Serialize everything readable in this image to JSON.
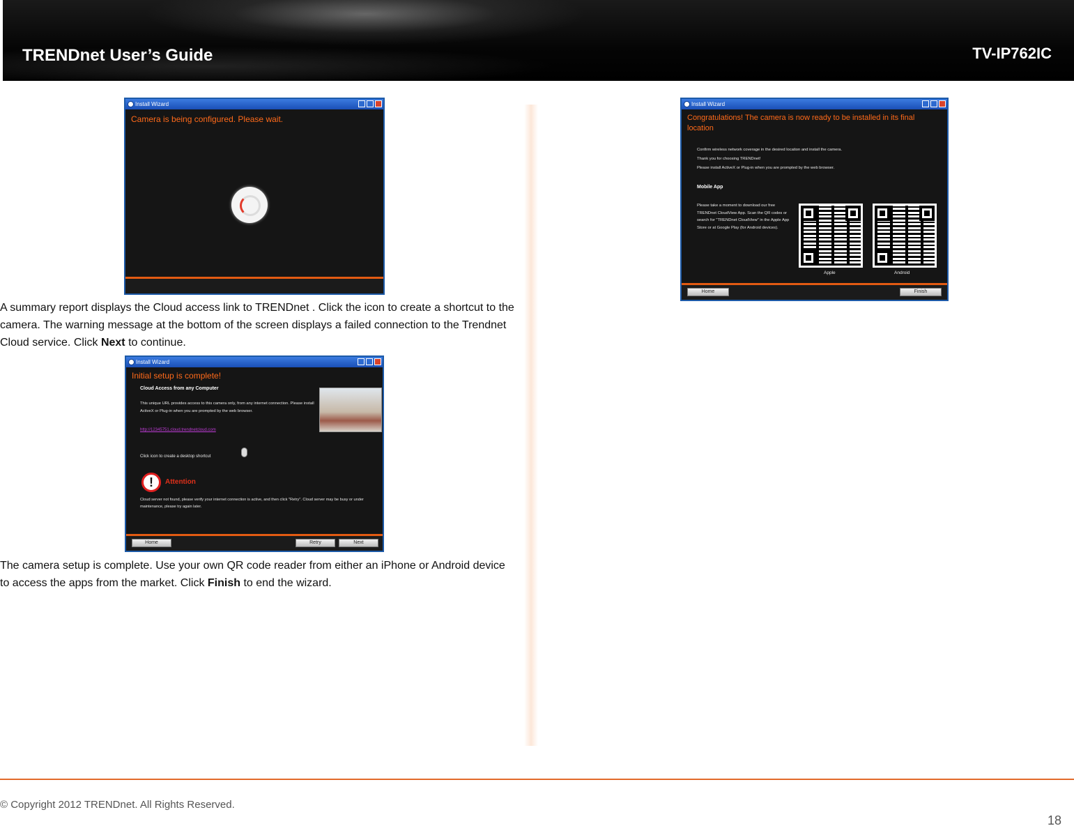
{
  "header": {
    "title": "TRENDnet User’s Guide",
    "model": "TV-IP762IC"
  },
  "screenshot1": {
    "window_title": "Install Wizard",
    "heading": "Camera is being configured. Please wait."
  },
  "paragraph1": {
    "text_before": "A summary report displays the Cloud access link to TRENDnet . Click the icon to create a shortcut to the camera. The warning message at the bottom of the screen displays a failed connection to the Trendnet Cloud service. Click ",
    "bold": "Next",
    "text_after": " to continue."
  },
  "screenshot2": {
    "window_title": "Install Wizard",
    "heading": "Initial setup is complete!",
    "section_title": "Cloud Access from any Computer",
    "description": "This unique URL provides access to this camera only, from any internet connection. Please install ActiveX or Plug-in when you are prompted by the web browser.",
    "link": "http://12345751.cloud.trendnetcloud.com",
    "shortcut_text": "Click icon to create a desktop shortcut",
    "attention_label": "Attention",
    "attention_text": "Cloud server not found, please verify your internet connection is active, and then click \"Retry\". Cloud server may be busy or under maintenance, please try again later.",
    "buttons": {
      "home": "Home",
      "retry": "Retry",
      "next": "Next"
    }
  },
  "paragraph2": {
    "text_before": "The camera setup is complete. Use your own QR code reader from either an iPhone or Android device to access the apps from the market. Click ",
    "bold": "Finish",
    "text_after": " to end the wizard."
  },
  "screenshot3": {
    "window_title": "Install Wizard",
    "heading": "Congratulations! The camera is now ready to be installed in its final location",
    "lines": [
      "Confirm wireless network coverage in the desired location and install the camera.",
      "Thank you for choosing TRENDnet!",
      "Please install ActiveX or Plug-in when you are prompted by the web browser."
    ],
    "mobile_title": "Mobile App",
    "mobile_text": "Please take a moment to download our free TRENDnet CloudView App. Scan the QR codes or search for \"TRENDnet CloudView\" in the Apple App Store or at Google Play (for Android devices).",
    "qr_labels": {
      "apple": "Apple",
      "android": "Android"
    },
    "buttons": {
      "home": "Home",
      "finish": "Finish"
    }
  },
  "footer": {
    "copyright": "© Copyright 2012 TRENDnet. All Rights Reserved.",
    "page_number": "18"
  }
}
